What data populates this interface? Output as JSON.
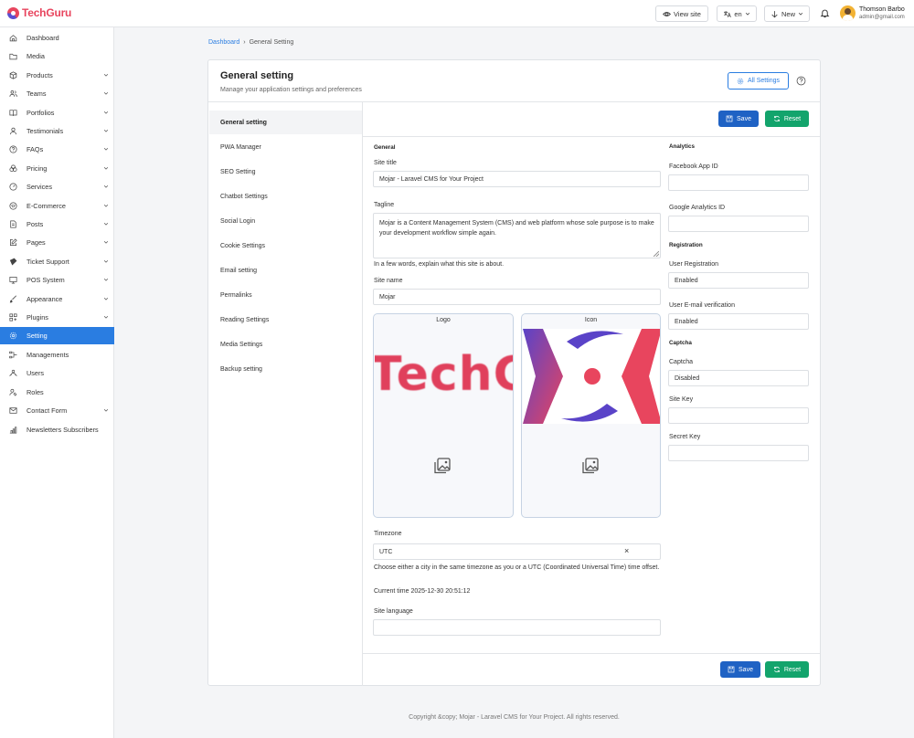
{
  "brand": {
    "name": "TechGuru"
  },
  "topbar": {
    "view_site": "View site",
    "language": "en",
    "new": "New",
    "user_name": "Thomson Barbo",
    "user_email": "admin@gmail.com"
  },
  "sidebar": {
    "items": [
      {
        "label": "Dashboard",
        "icon": "home-icon",
        "chevron": false
      },
      {
        "label": "Media",
        "icon": "folder-icon",
        "chevron": false
      },
      {
        "label": "Products",
        "icon": "box-icon",
        "chevron": true
      },
      {
        "label": "Teams",
        "icon": "users-icon",
        "chevron": true
      },
      {
        "label": "Portfolios",
        "icon": "book-icon",
        "chevron": true
      },
      {
        "label": "Testimonials",
        "icon": "person-icon",
        "chevron": true
      },
      {
        "label": "FAQs",
        "icon": "question-icon",
        "chevron": true
      },
      {
        "label": "Pricing",
        "icon": "coins-icon",
        "chevron": true
      },
      {
        "label": "Services",
        "icon": "gauge-icon",
        "chevron": true
      },
      {
        "label": "E-Commerce",
        "icon": "cart-icon",
        "chevron": true
      },
      {
        "label": "Posts",
        "icon": "document-icon",
        "chevron": true
      },
      {
        "label": "Pages",
        "icon": "edit-icon",
        "chevron": true
      },
      {
        "label": "Ticket Support",
        "icon": "ticket-icon",
        "chevron": true
      },
      {
        "label": "POS System",
        "icon": "monitor-icon",
        "chevron": true
      },
      {
        "label": "Appearance",
        "icon": "brush-icon",
        "chevron": true
      },
      {
        "label": "Plugins",
        "icon": "plugin-icon",
        "chevron": true
      },
      {
        "label": "Setting",
        "icon": "gear-icon",
        "chevron": false,
        "active": true
      },
      {
        "label": "Managements",
        "icon": "flow-icon",
        "chevron": false
      },
      {
        "label": "Users",
        "icon": "user-group-icon",
        "chevron": false
      },
      {
        "label": "Roles",
        "icon": "roles-icon",
        "chevron": false
      },
      {
        "label": "Contact Form",
        "icon": "mail-icon",
        "chevron": true
      },
      {
        "label": "Newsletters Subscribers",
        "icon": "chart-icon",
        "chevron": false
      }
    ]
  },
  "breadcrumb": {
    "root": "Dashboard",
    "separator": "›",
    "current": "General Setting"
  },
  "card": {
    "title": "General setting",
    "subtitle": "Manage your application settings and preferences",
    "all_settings": "All Settings"
  },
  "settings_menu": [
    {
      "label": "General setting",
      "active": true
    },
    {
      "label": "PWA Manager"
    },
    {
      "label": "SEO Setting"
    },
    {
      "label": "Chatbot Settings"
    },
    {
      "label": "Social Login"
    },
    {
      "label": "Cookie Settings"
    },
    {
      "label": "Email setting"
    },
    {
      "label": "Permalinks"
    },
    {
      "label": "Reading Settings"
    },
    {
      "label": "Media Settings"
    },
    {
      "label": "Backup setting"
    }
  ],
  "actions": {
    "save": "Save",
    "reset": "Reset"
  },
  "general": {
    "heading": "General",
    "site_title_label": "Site title",
    "site_title_value": "Mojar - Laravel CMS for Your Project",
    "tagline_label": "Tagline",
    "tagline_value": "Mojar is a Content Management System (CMS) and web platform whose sole purpose is to make your development workflow simple again.",
    "tagline_help": "In a few words, explain what this site is about.",
    "site_name_label": "Site name",
    "site_name_value": "Mojar",
    "logo_label": "Logo",
    "logo_preview_text": "TechG",
    "icon_label": "Icon",
    "timezone_label": "Timezone",
    "timezone_value": "UTC",
    "timezone_clear": "×",
    "timezone_help": "Choose either a city in the same timezone as you or a UTC (Coordinated Universal Time) time offset.",
    "current_time": "Current time 2025-12-30 20:51:12",
    "site_language_label": "Site language",
    "site_language_value": ""
  },
  "analytics": {
    "heading": "Analytics",
    "facebook_label": "Facebook App ID",
    "facebook_value": "",
    "google_label": "Google Analytics ID",
    "google_value": ""
  },
  "registration": {
    "heading": "Registration",
    "user_registration_label": "User Registration",
    "user_registration_value": "Enabled",
    "email_verification_label": "User E-mail verification",
    "email_verification_value": "Enabled"
  },
  "captcha": {
    "heading": "Captcha",
    "captcha_label": "Captcha",
    "captcha_value": "Disabled",
    "site_key_label": "Site Key",
    "site_key_value": "",
    "secret_key_label": "Secret Key",
    "secret_key_value": ""
  },
  "footer": {
    "text": "Copyright &copy; Mojar - Laravel CMS for Your Project. All rights reserved."
  },
  "colors": {
    "primary": "#2a7de1",
    "save": "#1f62c4",
    "reset": "#13a46c",
    "brand": "#e8455e"
  }
}
